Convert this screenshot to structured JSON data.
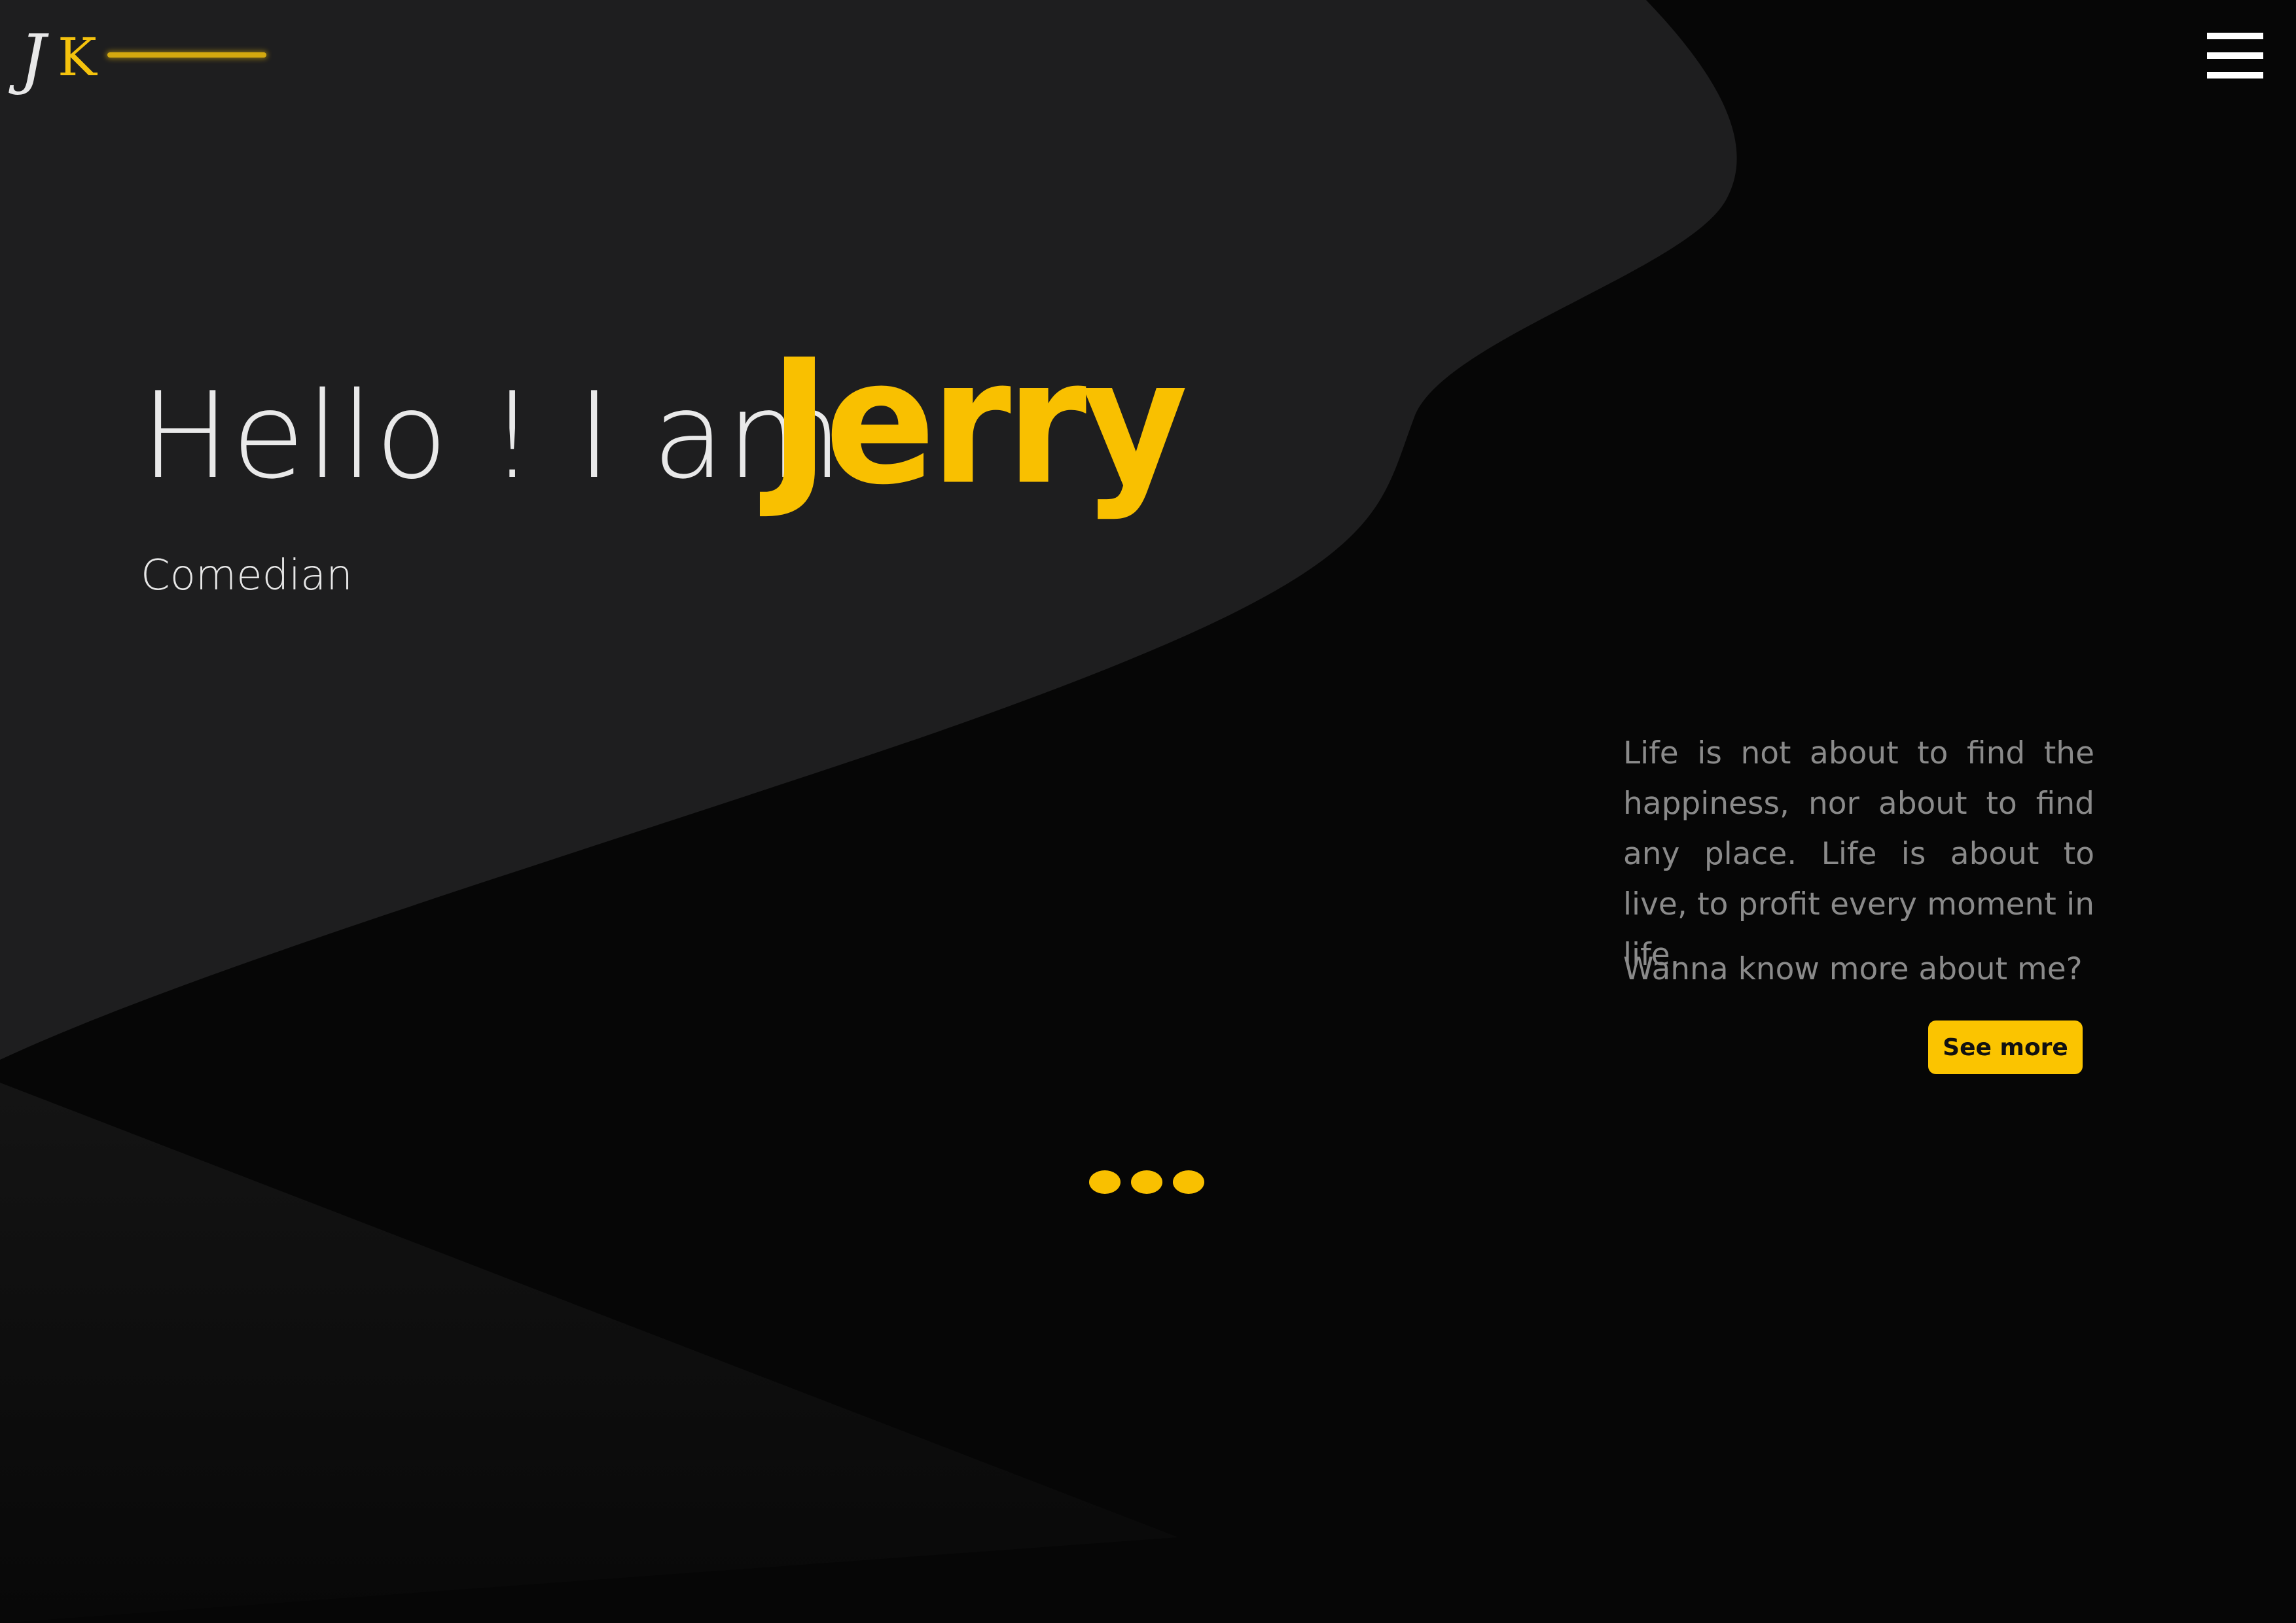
{
  "logo": {
    "letter_j": "J",
    "letter_k": "K"
  },
  "header": {
    "menu_icon": "hamburger-menu-icon"
  },
  "hero": {
    "greeting": "Hello ! I am",
    "name": "Jerry",
    "role": "Comedian"
  },
  "about": {
    "quote": "Life is not about to find the happiness, nor about to find any place. Life is about to live, to profit every moment in life.",
    "question": "Wanna know more about me?",
    "button_label": "See more"
  },
  "pager": {
    "dot_count": 3
  },
  "colors": {
    "accent": "#f9c000",
    "background": "#060606",
    "panel": "#1e1e1f",
    "text_light": "#e9e9e9",
    "text_muted": "#8a8a8a"
  }
}
